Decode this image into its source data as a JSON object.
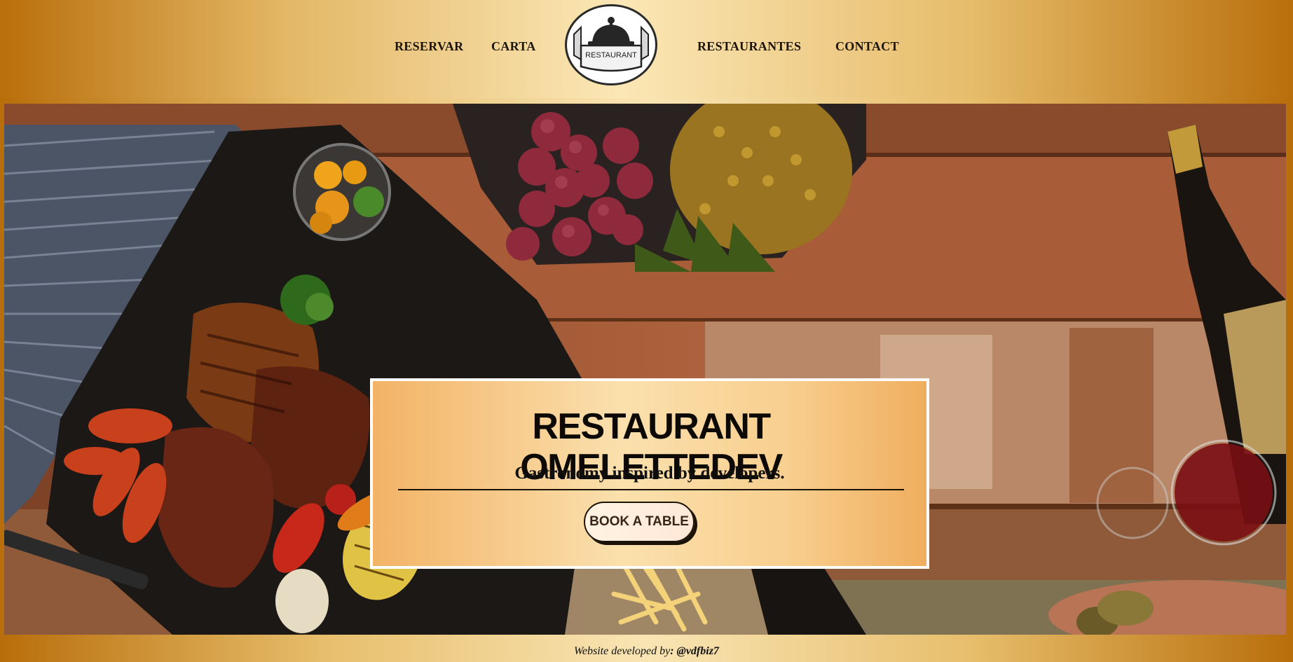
{
  "nav": {
    "links": [
      "RESERVAR",
      "CARTA",
      "RESTAURANTES",
      "CONTACT"
    ],
    "logo_text": "RESTAURANT"
  },
  "hero": {
    "title": "RESTAURANT OMELETTEDEV",
    "subtitle": "Gastronomy inspired by developers.",
    "button_label": "BOOK A TABLE"
  },
  "footer": {
    "prefix": "Website developed by",
    "handle": ": @vdfbiz7"
  },
  "colors": {
    "gold_dark": "#b86e0a",
    "gold_light": "#f9e5b4",
    "card_orange": "#f2b366",
    "text_dark": "#1c1408"
  }
}
